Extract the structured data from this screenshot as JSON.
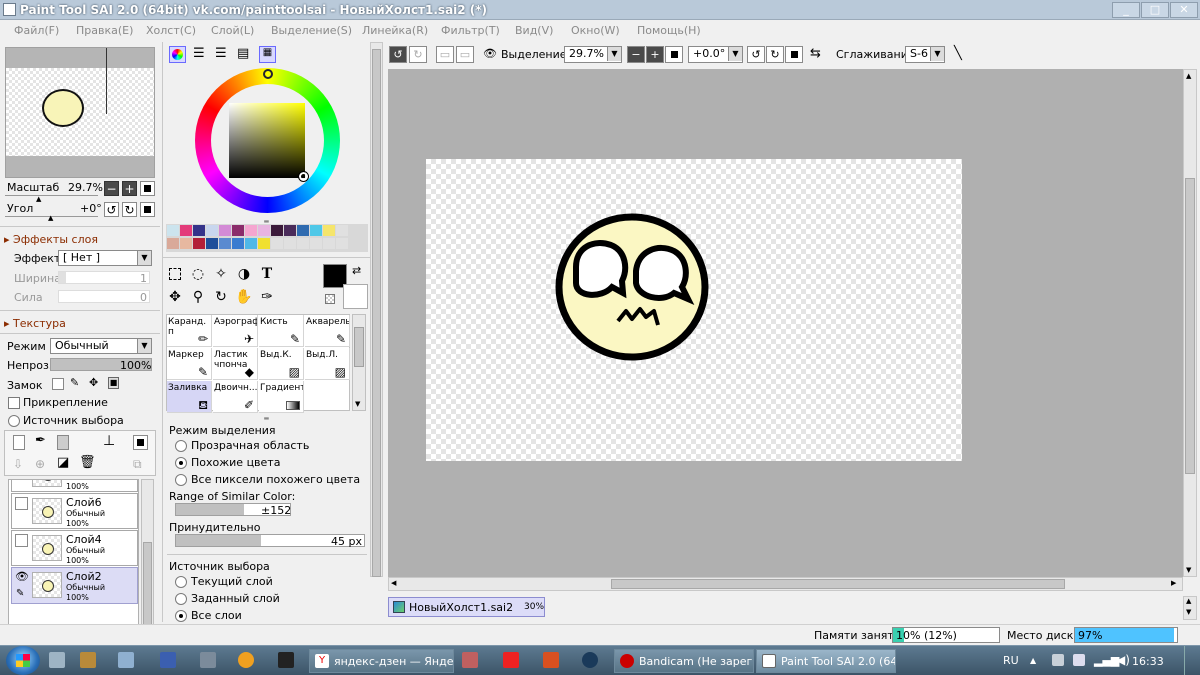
{
  "window": {
    "title": "Paint Tool SAI 2.0 (64bit) vk.com/painttoolsai - НовыйХолст1.sai2 (*)"
  },
  "menu": [
    "Файл(F)",
    "Правка(E)",
    "Холст(C)",
    "Слой(L)",
    "Выделение(S)",
    "Линейка(R)",
    "Фильтр(T)",
    "Вид(V)",
    "Окно(W)",
    "Помощь(H)"
  ],
  "navigator": {
    "zoom_label": "Масштаб",
    "zoom_value": "29.7%",
    "angle_label": "Угол",
    "angle_value": "+0°"
  },
  "layer_effects": {
    "header": "Эффекты слоя",
    "effect_label": "Эффект",
    "effect_value": "[ Нет ]",
    "width_label": "Ширина",
    "width_value": "1",
    "strength_label": "Сила",
    "strength_value": "0"
  },
  "texture": {
    "header": "Текстура",
    "mode_label": "Режим",
    "mode_value": "Обычный",
    "opacity_label": "Непроз.",
    "opacity_value": "100%",
    "lock_label": "Замок",
    "clip_label": "Прикрепление",
    "sel_source_label": "Источник выбора"
  },
  "layers": [
    {
      "name": "",
      "mode": "",
      "opacity": "100%"
    },
    {
      "name": "Слой6",
      "mode": "Обычный",
      "opacity": "100%"
    },
    {
      "name": "Слой4",
      "mode": "Обычный",
      "opacity": "100%"
    },
    {
      "name": "Слой2",
      "mode": "Обычный",
      "opacity": "100%"
    }
  ],
  "palette": {
    "row1": [
      "#cce4ee",
      "#e33b7a",
      "#35338a",
      "#c8d6ee",
      "#d38bd6",
      "#8b2c6b",
      "#f5a6d0",
      "#e8b4e0",
      "#3b1a3a",
      "#4a2b5a",
      "#2f6bb0",
      "#4fc8e8",
      "#f5e56b",
      "#e0e0e0"
    ],
    "row2": [
      "#d9a999",
      "#e7b8a0",
      "#b32038",
      "#1e4e9a",
      "#5a8ad0",
      "#3a7bd0",
      "#4fb8e8",
      "#f0e030",
      "#e0e0e0",
      "#e0e0e0",
      "#e0e0e0",
      "#e0e0e0",
      "#e0e0e0",
      "#e0e0e0"
    ]
  },
  "brushes": [
    {
      "name": "Каранд. п",
      "icon": "pencil-icon"
    },
    {
      "name": "Аэрограф",
      "icon": "airbrush-icon"
    },
    {
      "name": "Кисть",
      "icon": "brush-icon"
    },
    {
      "name": "Акварель",
      "icon": "watercolor-icon"
    },
    {
      "name": "Маркер",
      "icon": "marker-icon"
    },
    {
      "name": "Ластик чпонча",
      "icon": "eraser-icon"
    },
    {
      "name": "Выд.К.",
      "icon": "select-pen-icon"
    },
    {
      "name": "Выд.Л.",
      "icon": "select-eraser-icon"
    },
    {
      "name": "Заливка",
      "icon": "bucket-icon"
    },
    {
      "name": "Двоичн...",
      "icon": "binary-pen-icon"
    },
    {
      "name": "Градиент",
      "icon": "gradient-icon"
    }
  ],
  "fill_options": {
    "mode_header": "Режим выделения",
    "modes": [
      "Прозрачная область",
      "Похожие цвета",
      "Все пиксели похожего цвета"
    ],
    "selected_mode": 1,
    "range_label": "Range of Similar Color:",
    "range_value": "±152",
    "forced_label": "Принудительно",
    "forced_value": "45 px",
    "source_header": "Источник выбора",
    "sources": [
      "Текущий слой",
      "Заданный слой",
      "Все слои"
    ]
  },
  "toolbar": {
    "selection_label": "Выделение",
    "zoom_value": "29.7%",
    "angle_value": "+0.0°",
    "smoothing_label": "Сглаживание",
    "smoothing_value": "S-6"
  },
  "doc_tab": {
    "name": "НовыйХолст1.sai2",
    "zoom": "30%"
  },
  "status": {
    "memory_label": "Памяти занято",
    "memory_value": "10% (12%)",
    "memory_pct": 0.1,
    "disk_label": "Место диска",
    "disk_value": "97%",
    "disk_pct": 0.97
  },
  "taskbar": {
    "tasks": [
      "яндекс-дзен — Янде...",
      "Bandicam (Не зарег...",
      "Paint Tool SAI 2.0 (64..."
    ],
    "lang": "RU",
    "time": "16:33"
  }
}
